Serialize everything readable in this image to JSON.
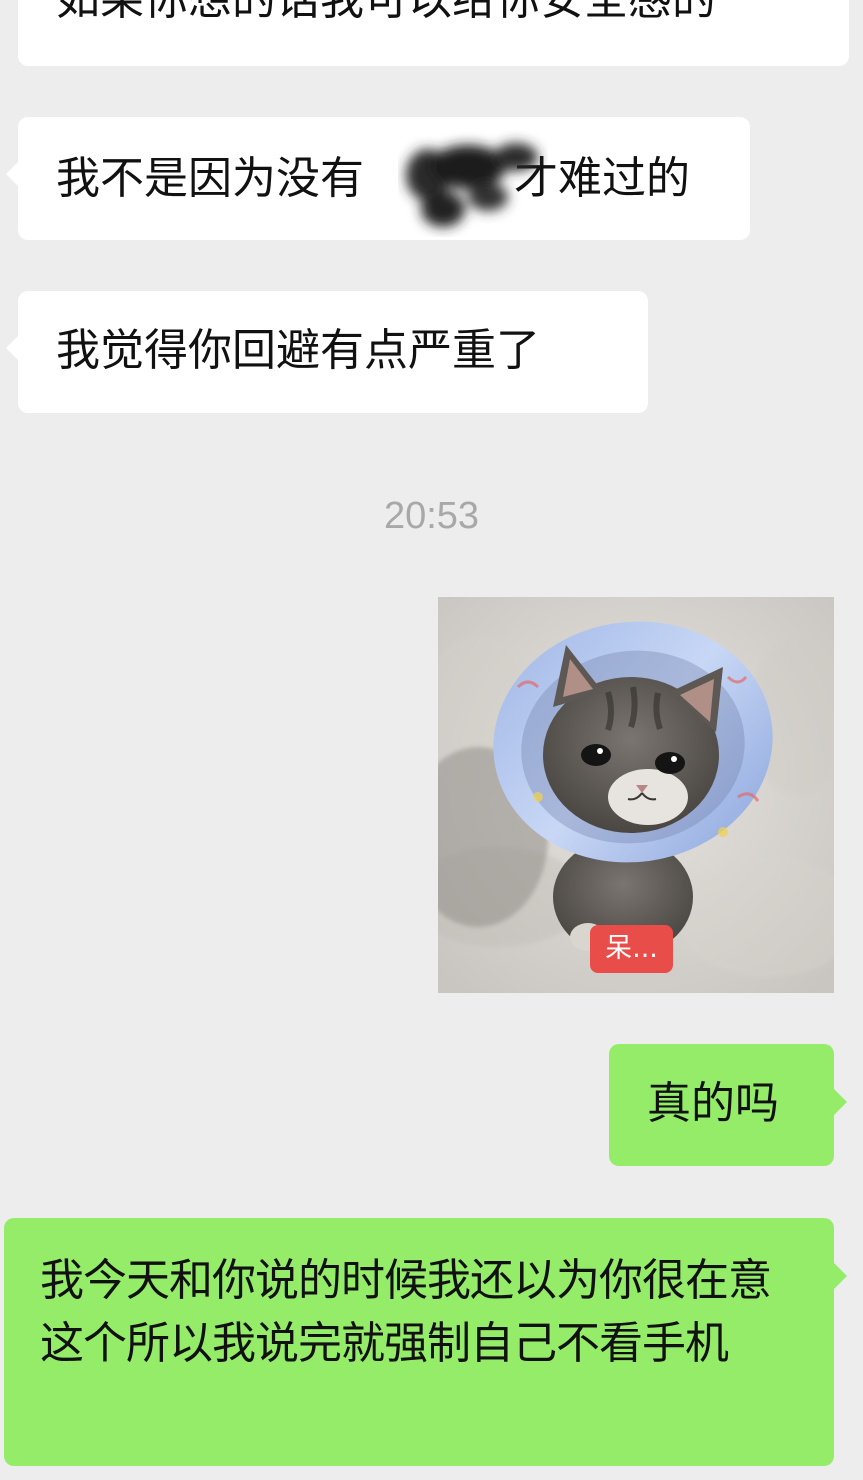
{
  "messages": [
    {
      "id": "m1",
      "direction": "incoming",
      "text": "如果你想的话我可以给你安全感的"
    },
    {
      "id": "m2",
      "direction": "incoming",
      "text_before": "我不是因为没有",
      "text_after": "才难过的"
    },
    {
      "id": "m3",
      "direction": "incoming",
      "text": "我觉得你回避有点严重了"
    },
    {
      "id": "m4",
      "direction": "outgoing",
      "text": "真的吗"
    },
    {
      "id": "m5",
      "direction": "outgoing",
      "text": "我今天和你说的时候我还以为你很在意这个所以我说完就强制自己不看手机"
    }
  ],
  "timestamp": "20:53",
  "sticker": {
    "subject": "kitten wearing cone collar",
    "caption": "呆..."
  },
  "colors": {
    "background": "#ededed",
    "incoming_bubble": "#ffffff",
    "outgoing_bubble": "#95ec69",
    "timestamp_text": "#a8a8a8",
    "sticker_label": "#e84d4a"
  }
}
